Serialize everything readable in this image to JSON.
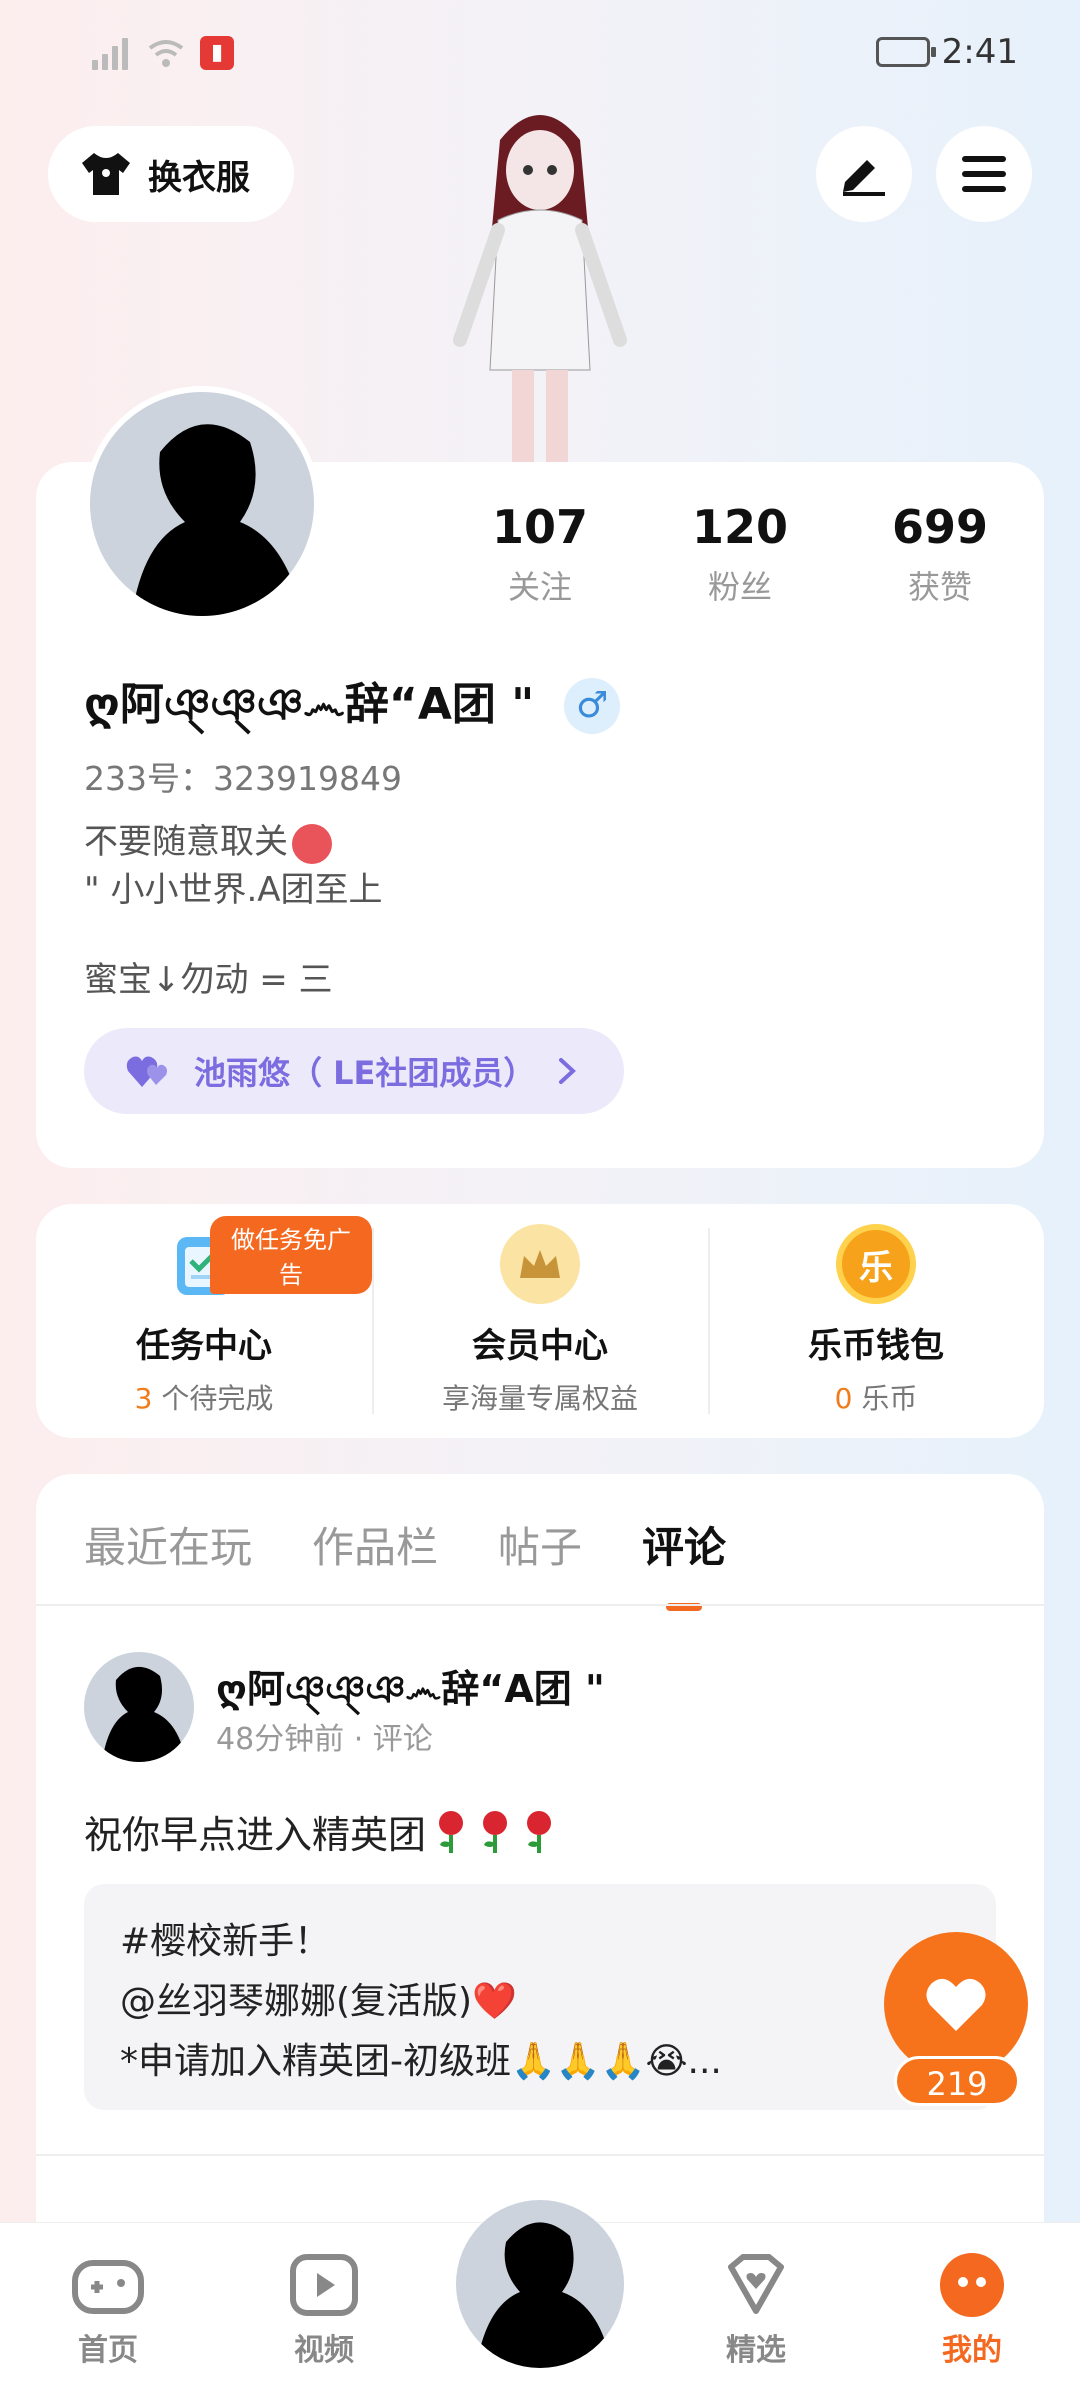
{
  "status_bar": {
    "time": "2:41"
  },
  "top": {
    "outfit_label": "换衣服"
  },
  "profile": {
    "stats": [
      {
        "value": "107",
        "label": "关注"
      },
      {
        "value": "120",
        "label": "粉丝"
      },
      {
        "value": "699",
        "label": "获赞"
      }
    ],
    "username": "ღ阿ঞ্ঞ্ঞ෴辞“A团 \"",
    "gender_symbol": "♂",
    "uid": "233号：323919849",
    "bio_line1": "不要随意取关",
    "bio_line2": "\" 小小世界.A团至上",
    "bio_line3": "蜜宝↓勿动 = 三",
    "group_label": "池雨悠（ LE社团成员）"
  },
  "services": [
    {
      "title": "任务中心",
      "count": "3",
      "sub": " 个待完成",
      "badge": "做任务免广告",
      "icon": "clipboard-icon"
    },
    {
      "title": "会员中心",
      "sub": "享海量专属权益",
      "icon": "crown-icon"
    },
    {
      "title": "乐币钱包",
      "count": "0",
      "sub": " 乐币",
      "icon": "coin-icon",
      "icon_text": "乐"
    }
  ],
  "tabs": [
    "最近在玩",
    "作品栏",
    "帖子",
    "评论"
  ],
  "active_tab": "评论",
  "post": {
    "name": "ღ阿ঞ্ঞ্ঞ෴辞“A团 \"",
    "meta": "48分钟前 · 评论",
    "text": "祝你早点进入精英团",
    "quote_lines": [
      "#樱校新手！",
      "@丝羽琴娜娜(复活版)❤️",
      "*申请加入精英团-初级班🙏🙏🙏😭..."
    ]
  },
  "like": {
    "count": "219"
  },
  "bottom_nav": [
    {
      "label": "首页",
      "icon": "gamepad-icon"
    },
    {
      "label": "视频",
      "icon": "play-icon"
    },
    {
      "label": "精选",
      "icon": "heart-diamond-icon"
    },
    {
      "label": "我的",
      "icon": "face-icon",
      "active": true
    }
  ],
  "colors": {
    "accent": "#f4691f",
    "purple": "#7b6de0"
  }
}
